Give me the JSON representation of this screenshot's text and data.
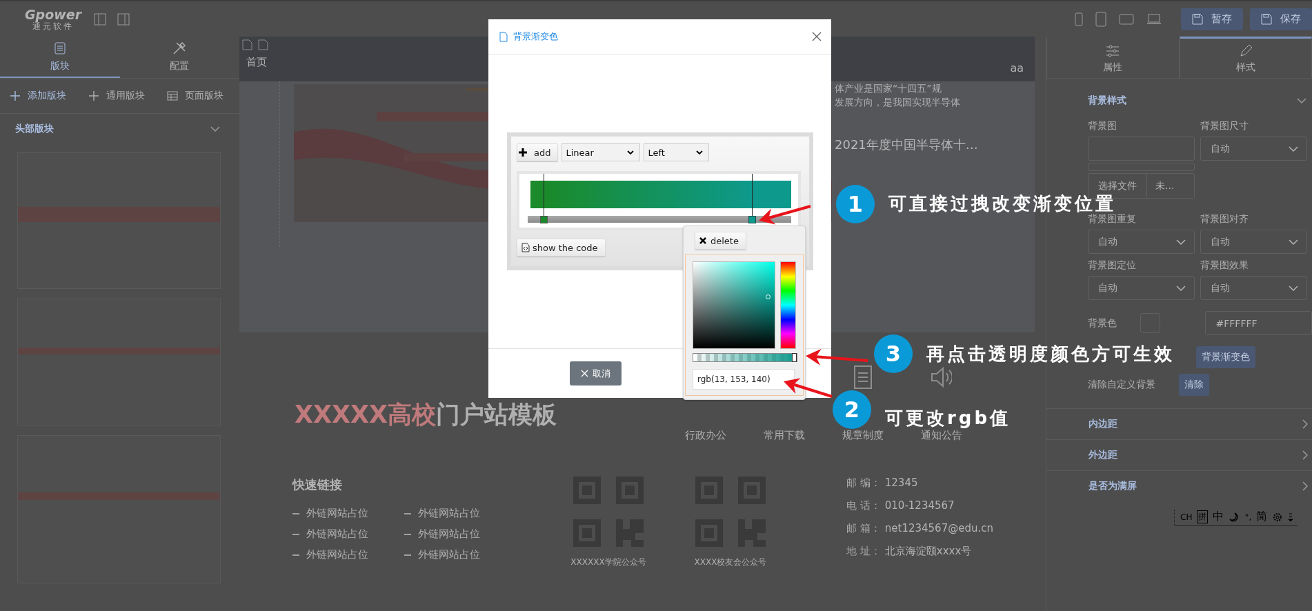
{
  "topbar": {
    "logo": {
      "wordmark": "Gpower",
      "subtitle": "通元软件"
    },
    "buttons": [
      "暂存",
      "保存"
    ]
  },
  "left_panel": {
    "tabs": [
      {
        "label": "版块",
        "selected": true
      },
      {
        "label": "配置",
        "selected": false
      }
    ],
    "actions": [
      {
        "label": "添加版块",
        "selected": true
      },
      {
        "label": "通用版块",
        "selected": false
      },
      {
        "label": "页面版块",
        "selected": false
      }
    ],
    "section": {
      "title": "头部版块",
      "expanded": true
    }
  },
  "canvas": {
    "nav": {
      "home": "首页",
      "user": "aa"
    },
    "news": [
      "体产业是国家“十四五”规",
      "发展方向，是我国实现半导体",
      "2021年度中国半导体十…"
    ],
    "site_title": {
      "highlight": "XXXXX高校",
      "rest": "门户站模板"
    },
    "shortcuts": [
      "行政办公",
      "常用下载",
      "规章制度",
      "通知公告"
    ],
    "quick_links": {
      "title": "快速链接",
      "links": [
        "外链网站占位",
        "外链网站占位",
        "外链网站占位",
        "外链网站占位",
        "外链网站占位",
        "外链网站占位"
      ]
    },
    "qr_codes": [
      "XXXXXX学院公众号",
      "XXXX校友会公众号"
    ],
    "contact": [
      {
        "label": "邮 编：",
        "value": "12345"
      },
      {
        "label": "电 话：",
        "value": "010-1234567"
      },
      {
        "label": "邮 箱：",
        "value": "net1234567@edu.cn"
      },
      {
        "label": "地 址：",
        "value": "北京海淀颐xxxx号"
      }
    ]
  },
  "right_panel": {
    "tabs": [
      {
        "label": "属性",
        "selected": false
      },
      {
        "label": "样式",
        "selected": true
      }
    ],
    "section": {
      "title": "背景样式",
      "expanded": true
    },
    "image_field": {
      "label": "背景图"
    },
    "size_select": {
      "label": "背景图尺寸",
      "value": "自动"
    },
    "file_picker": {
      "button": "选择文件",
      "status": "未..."
    },
    "selects": [
      {
        "label": "背景图重复",
        "value": "自动"
      },
      {
        "label": "背景图对齐",
        "value": "自动"
      },
      {
        "label": "背景图定位",
        "value": "自动"
      },
      {
        "label": "背景图效果",
        "value": "自动"
      }
    ],
    "color": {
      "label": "背景色",
      "value": "#FFFFFF"
    },
    "gradient": {
      "button": "背景渐变色"
    },
    "clear": {
      "label": "清除自定义背景",
      "button": "清除"
    },
    "collapsed": [
      {
        "title": "内边距",
        "expanded": false
      },
      {
        "title": "外边距",
        "expanded": false
      },
      {
        "title": "是否为满屏",
        "expanded": false
      }
    ]
  },
  "dialog": {
    "title": "背景渐变色",
    "add": "add",
    "type": "Linear",
    "direction": "Left",
    "stops": [
      {
        "color": "#1a8a2a",
        "level": 0.06,
        "selected": false
      },
      {
        "color": "#0d998c",
        "level": 0.85,
        "selected": true
      }
    ],
    "show_code": "show the code",
    "picker": {
      "delete": "delete",
      "alpha": {
        "level": 1
      },
      "value": "rgb(13, 153, 140)"
    },
    "cancel": "取消"
  },
  "annotations": [
    {
      "number": "1",
      "text": "可直接过拽改变渐变位置"
    },
    {
      "number": "3",
      "text": "再点击透明度颜色方可生效"
    },
    {
      "number": "2",
      "text": "可更改rgb值"
    }
  ],
  "ime_bar": {
    "language": "CH",
    "mode": "拼",
    "script": "中",
    "punctuation": "°,",
    "charset": "简"
  }
}
